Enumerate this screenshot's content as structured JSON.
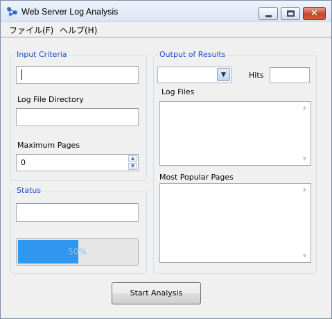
{
  "window": {
    "title": "Web Server Log Analysis",
    "close_glyph": "✕"
  },
  "menu": {
    "file": "ファイル(F)",
    "help": "ヘルプ(H)"
  },
  "input_criteria": {
    "title": "Input Criteria",
    "search_value": "",
    "log_dir_label": "Log File Directory",
    "log_dir_value": "",
    "max_pages_label": "Maximum Pages",
    "max_pages_value": "0"
  },
  "status": {
    "title": "Status",
    "status_text": "",
    "progress_percent": 50,
    "progress_label": "50%"
  },
  "output": {
    "title": "Output of Results",
    "combo_value": "",
    "hits_label": "Hits",
    "hits_value": "",
    "log_files_label": "Log Files",
    "log_files_items": [],
    "popular_pages_label": "Most Popular Pages",
    "popular_pages_items": []
  },
  "actions": {
    "start_label": "Start Analysis"
  },
  "colors": {
    "group_title": "#1e50c8",
    "progress_fill": "#2f97ee"
  }
}
